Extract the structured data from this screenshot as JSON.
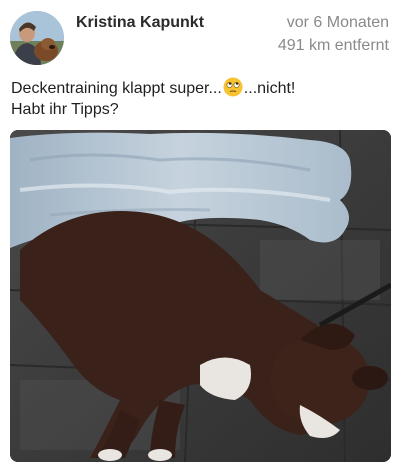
{
  "post": {
    "author": "Kristina Kapunkt",
    "time_ago": "vor 6 Monaten",
    "distance": "491 km entfernt",
    "text_part1": "Deckentraining klappt super...",
    "emoji": "face-with-rolling-eyes",
    "text_part2": "...nicht!",
    "text_line2": "Habt ihr Tipps?"
  },
  "colors": {
    "author": "#2b2b2b",
    "meta": "#8a8a8a",
    "text": "#1f1f1f"
  }
}
